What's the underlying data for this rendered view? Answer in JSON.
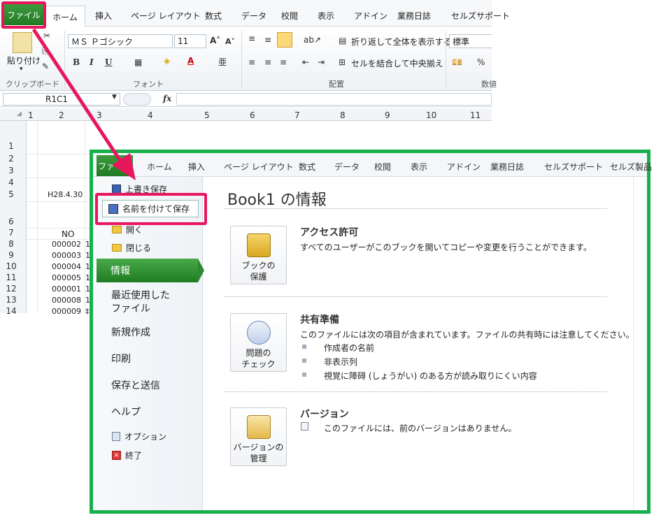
{
  "ribbon": {
    "tabs": [
      "ファイル",
      "ホーム",
      "挿入",
      "ページ レイアウト",
      "数式",
      "データ",
      "校閲",
      "表示",
      "アドイン",
      "業務日誌",
      "セルズサポート"
    ],
    "paste_label": "貼り付け",
    "paste_sub": "▾",
    "font_name": "ＭＳ Ｐゴシック",
    "font_size": "11",
    "wrap_text": "折り返して全体を表示する",
    "merge_center": "セルを結合して中央揃え",
    "number_format": "標準",
    "groups": {
      "clipboard": "クリップボード",
      "font": "フォント",
      "alignment": "配置",
      "number": "数値"
    },
    "bold": "B",
    "italic": "I",
    "underline": "U",
    "fx": "fx",
    "percent": "%"
  },
  "formula_bar": {
    "name_box": "R1C1"
  },
  "grid": {
    "columns": [
      "1",
      "2",
      "3",
      "4",
      "5",
      "6",
      "7",
      "8",
      "9",
      "10",
      "11"
    ],
    "rows": [
      "1",
      "2",
      "3",
      "4",
      "5",
      "6",
      "7",
      "8",
      "9",
      "10",
      "11",
      "12",
      "13",
      "14"
    ],
    "cells": {
      "date": "H28.4.30",
      "no_header": "NO",
      "ids": [
        "000002",
        "000003",
        "000004",
        "000005",
        "000001",
        "000008",
        "000009"
      ],
      "col3_chars": [
        "1",
        "1",
        "1",
        "1",
        "1",
        "1",
        "‡"
      ]
    }
  },
  "backstage": {
    "tabs": [
      "ファイル",
      "ホーム",
      "挿入",
      "ページ レイアウト",
      "数式",
      "データ",
      "校閲",
      "表示",
      "アドイン",
      "業務日誌",
      "セルズサポート",
      "セルズ製品"
    ],
    "nav": {
      "overwrite_save": "上書き保存",
      "save_as": "名前を付けて保存",
      "open": "開く",
      "close": "閉じる",
      "info": "情報",
      "recent": "最近使用した\nファイル",
      "new": "新規作成",
      "print": "印刷",
      "save_send": "保存と送信",
      "help": "ヘルプ",
      "options": "オプション",
      "exit": "終了"
    },
    "title": "Book1 の情報",
    "sections": {
      "access": {
        "button": "ブックの\n保護",
        "title": "アクセス許可",
        "text": "すべてのユーザーがこのブックを開いてコピーや変更を行うことができます。"
      },
      "prepare": {
        "button": "問題の\nチェック",
        "title": "共有準備",
        "text": "このファイルには次の項目が含まれています。ファイルの共有時には注意してください。",
        "items": [
          "作成者の名前",
          "非表示列",
          "視覚に障碍 (しょうがい) のある方が読み取りにくい内容"
        ]
      },
      "versions": {
        "button": "バージョンの\n管理",
        "title": "バージョン",
        "text": "このファイルには、前のバージョンはありません。"
      }
    }
  },
  "colors": {
    "highlight_red": "#e8175d",
    "backstage_border": "#17b04c",
    "file_green": "#2a8a2e",
    "arrow": "#e8175d"
  }
}
